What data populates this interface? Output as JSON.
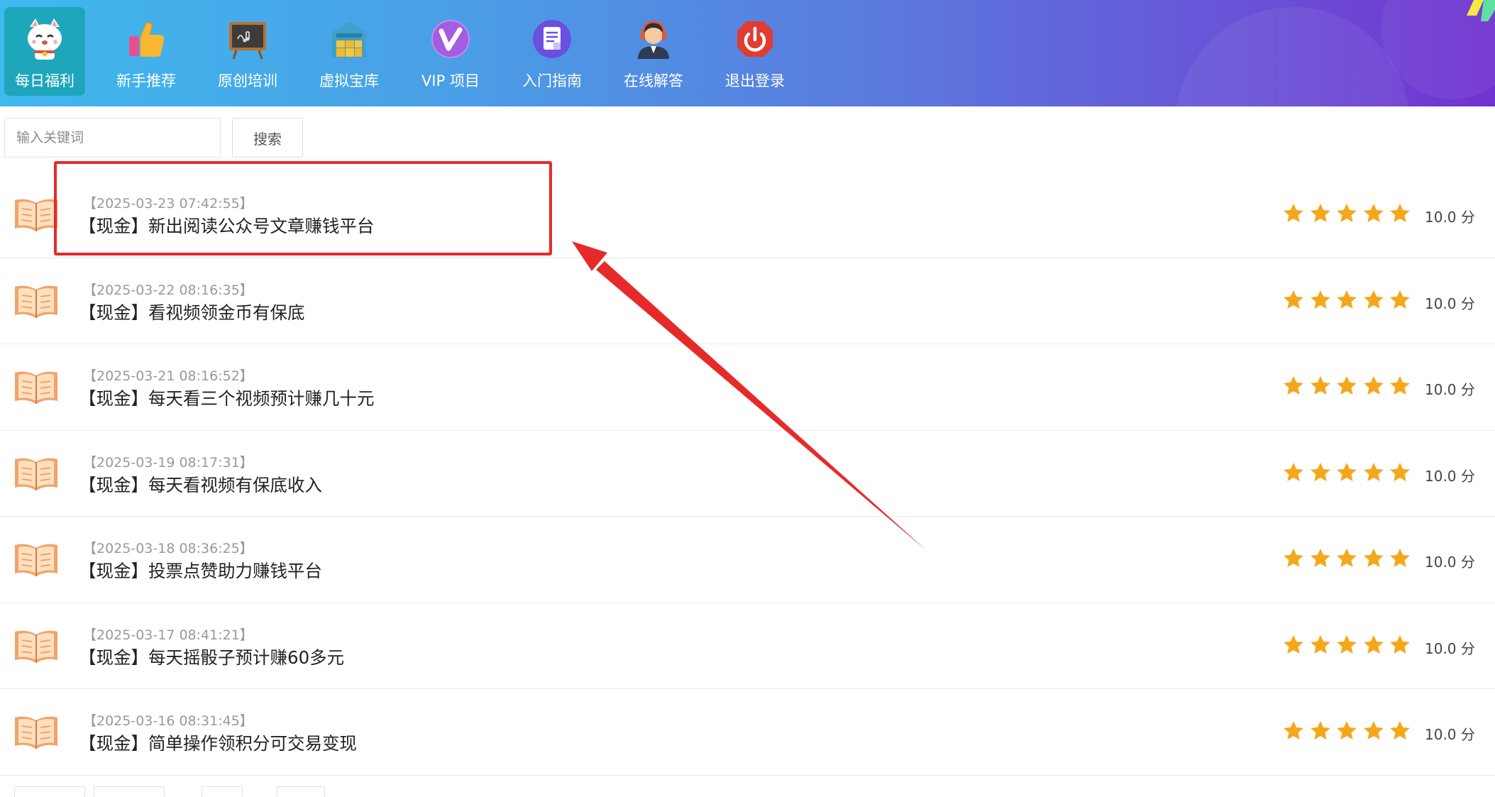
{
  "nav": {
    "items": [
      {
        "label": "每日福利",
        "icon": "lucky-cat-icon",
        "active": true
      },
      {
        "label": "新手推荐",
        "icon": "thumbs-up-icon",
        "active": false
      },
      {
        "label": "原创培训",
        "icon": "blackboard-icon",
        "active": false
      },
      {
        "label": "虚拟宝库",
        "icon": "warehouse-icon",
        "active": false
      },
      {
        "label": "VIP 项目",
        "icon": "vip-badge-icon",
        "active": false
      },
      {
        "label": "入门指南",
        "icon": "document-icon",
        "active": false
      },
      {
        "label": "在线解答",
        "icon": "customer-service-icon",
        "active": false
      },
      {
        "label": "退出登录",
        "icon": "power-icon",
        "active": false
      }
    ]
  },
  "search": {
    "placeholder": "输入关键词",
    "button_label": "搜索"
  },
  "articles": [
    {
      "date": "【2025-03-23 07:42:55】",
      "title": "【现金】新出阅读公众号文章赚钱平台",
      "rating": 5,
      "score": "10.0 分",
      "highlighted": true
    },
    {
      "date": "【2025-03-22 08:16:35】",
      "title": "【现金】看视频领金币有保底",
      "rating": 5,
      "score": "10.0 分"
    },
    {
      "date": "【2025-03-21 08:16:52】",
      "title": "【现金】每天看三个视频预计赚几十元",
      "rating": 5,
      "score": "10.0 分"
    },
    {
      "date": "【2025-03-19 08:17:31】",
      "title": "【现金】每天看视频有保底收入",
      "rating": 5,
      "score": "10.0 分"
    },
    {
      "date": "【2025-03-18 08:36:25】",
      "title": "【现金】投票点赞助力赚钱平台",
      "rating": 5,
      "score": "10.0 分"
    },
    {
      "date": "【2025-03-17 08:41:21】",
      "title": "【现金】每天摇骰子预计赚60多元",
      "rating": 5,
      "score": "10.0 分"
    },
    {
      "date": "【2025-03-16 08:31:45】",
      "title": "【现金】简单操作领积分可交易变现",
      "rating": 5,
      "score": "10.0 分"
    }
  ],
  "colors": {
    "annotation_red": "#e62a2a",
    "star_gold": "#f5a71c",
    "book_orange": "#f2a36b"
  }
}
